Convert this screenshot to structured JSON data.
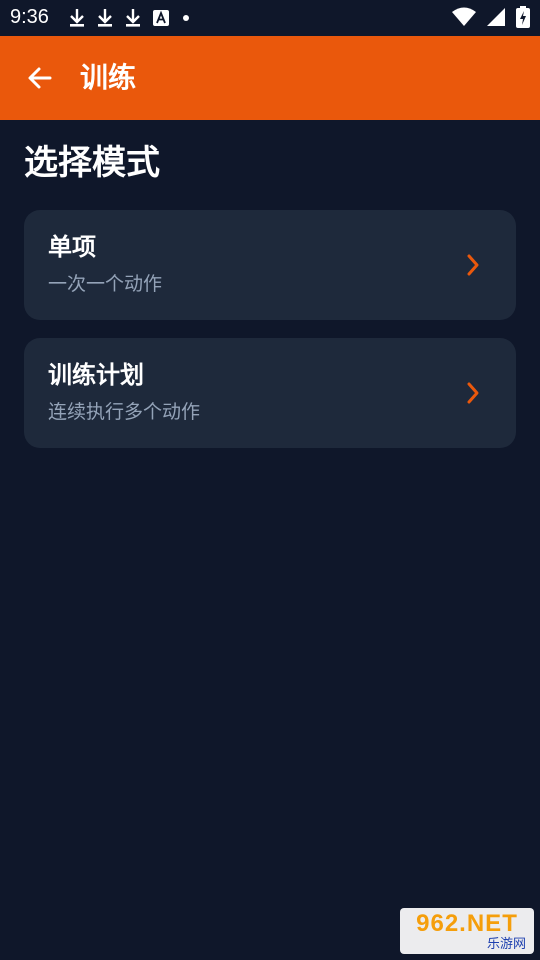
{
  "status_bar": {
    "time": "9:36",
    "notification_icons": [
      "download-icon",
      "download-icon",
      "download-icon",
      "font-a-icon",
      "dot-icon"
    ],
    "right_icons": [
      "wifi-icon",
      "signal-icon",
      "battery-charging-icon"
    ]
  },
  "app_bar": {
    "title": "训练",
    "back_icon": "arrow-left-icon",
    "color": "#ea580c"
  },
  "page": {
    "section_title": "选择模式",
    "background": "#0f172a"
  },
  "options": [
    {
      "title": "单项",
      "subtitle": "一次一个动作",
      "icon": "chevron-right-icon"
    },
    {
      "title": "训练计划",
      "subtitle": "连续执行多个动作",
      "icon": "chevron-right-icon"
    }
  ],
  "colors": {
    "accent": "#ea580c",
    "card": "#1e293b",
    "subtitle": "#94a3b8"
  },
  "watermark": {
    "main": "962.NET",
    "sub": "乐游网"
  }
}
